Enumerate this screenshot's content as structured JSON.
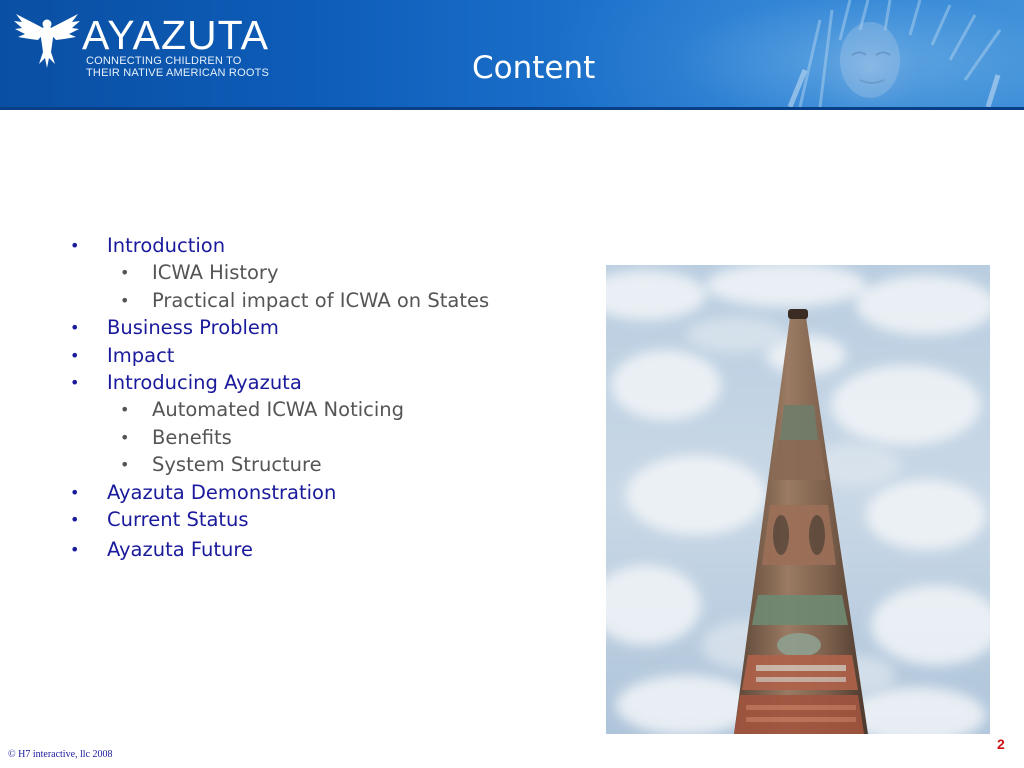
{
  "header": {
    "logo_word": "AYAZUTA",
    "tagline_line1": "CONNECTING CHILDREN TO",
    "tagline_line2": "THEIR NATIVE AMERICAN ROOTS",
    "title": "Content"
  },
  "outline": {
    "introduction": "Introduction",
    "icwa_history": "ICWA History",
    "practical_impact": "Practical impact of ICWA on States",
    "business_problem": "Business Problem",
    "impact": "Impact",
    "introducing_ayazuta": "Introducing Ayazuta",
    "automated_noticing": "Automated ICWA Noticing",
    "benefits": "Benefits",
    "system_structure": "System Structure",
    "demonstration": "Ayazuta Demonstration",
    "current_status": "Current Status",
    "future": "Ayazuta Future"
  },
  "footer": {
    "copyright": "© H7 interactive, llc  2008",
    "page_number": "2"
  },
  "colors": {
    "header_blue": "#0d5cb8",
    "level1_text": "#1a1a9c",
    "level2_text": "#555555",
    "page_number": "#d01010"
  },
  "icons": [
    "eagle-logo-icon",
    "bullet-icon"
  ]
}
